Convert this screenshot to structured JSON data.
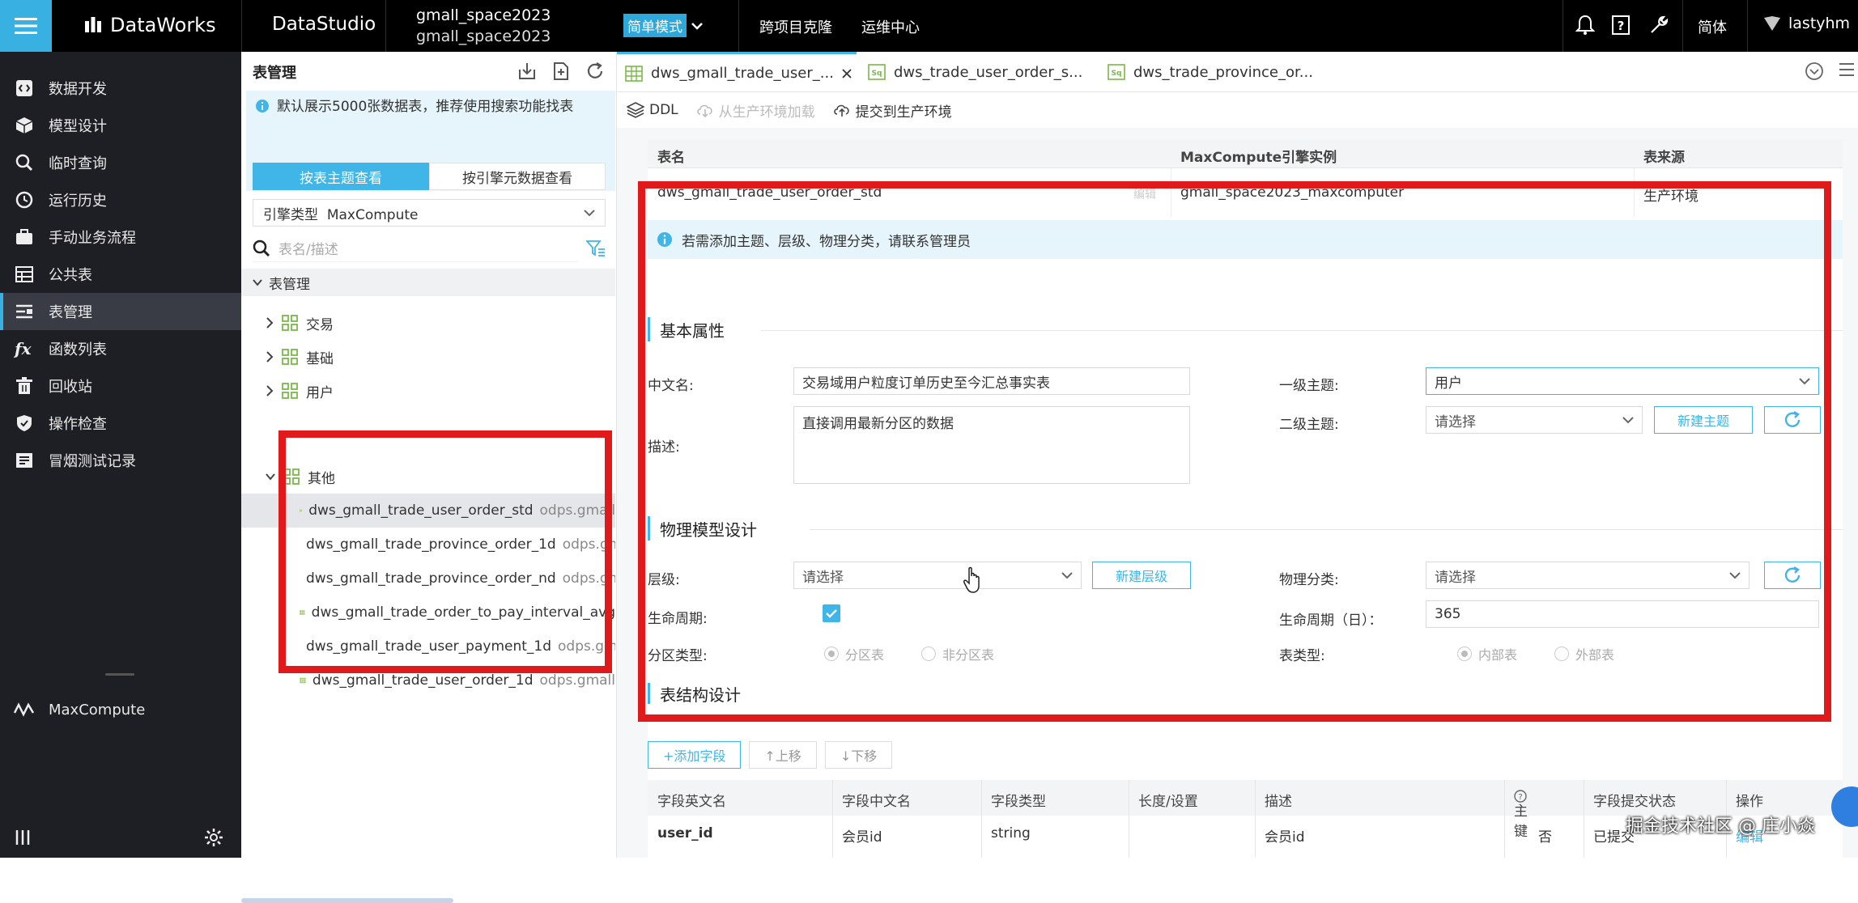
{
  "topbar": {
    "brand": "DataWorks",
    "studio": "DataStudio",
    "workspace_line1": "gmall_space2023",
    "workspace_line2": "gmall_space2023",
    "mode": "简单模式",
    "nav": [
      "跨项目克隆",
      "运维中心"
    ],
    "lang": "简体",
    "user": "lastyhm"
  },
  "sidebar": {
    "items": [
      {
        "label": "数据开发",
        "icon": "code-icon"
      },
      {
        "label": "模型设计",
        "icon": "cube-icon"
      },
      {
        "label": "临时查询",
        "icon": "search-icon"
      },
      {
        "label": "运行历史",
        "icon": "clock-icon"
      },
      {
        "label": "手动业务流程",
        "icon": "briefcase-icon"
      },
      {
        "label": "公共表",
        "icon": "table-icon"
      },
      {
        "label": "表管理",
        "icon": "table-manage-icon"
      },
      {
        "label": "函数列表",
        "icon": "function-icon"
      },
      {
        "label": "回收站",
        "icon": "trash-icon"
      },
      {
        "label": "操作检查",
        "icon": "shield-icon"
      },
      {
        "label": "冒烟测试记录",
        "icon": "record-icon"
      }
    ],
    "engine": "MaxCompute"
  },
  "tree": {
    "title": "表管理",
    "info": "默认展示5000张数据表，推荐使用搜索功能找表",
    "tab_subject": "按表主题查看",
    "tab_engine": "按引擎元数据查看",
    "engine_type_label": "引擎类型",
    "engine_type_value": "MaxCompute",
    "search_placeholder": "表名/描述",
    "root": "表管理",
    "folders": [
      "交易",
      "基础",
      "用户",
      "其他"
    ],
    "files": [
      {
        "name": "dws_gmall_trade_user_order_std",
        "path": "odps.gmall"
      },
      {
        "name": "dws_gmall_trade_province_order_1d",
        "path": "odps.gmall"
      },
      {
        "name": "dws_gmall_trade_province_order_nd",
        "path": "odps.gmall"
      },
      {
        "name": "dws_gmall_trade_order_to_pay_interval_avg",
        "path": ""
      },
      {
        "name": "dws_gmall_trade_user_payment_1d",
        "path": "odps.gmall"
      },
      {
        "name": "dws_gmall_trade_user_order_1d",
        "path": "odps.gmall"
      }
    ]
  },
  "editor": {
    "tabs": [
      "dws_gmall_trade_user_...",
      "dws_trade_user_order_s...",
      "dws_trade_province_or..."
    ],
    "toolbar": {
      "ddl": "DDL",
      "load": "从生产环境加载",
      "submit": "提交到生产环境"
    },
    "table_header": {
      "name": "表名",
      "instance": "MaxCompute引擎实例",
      "source": "表来源"
    },
    "table_row": {
      "name": "dws_gmall_trade_user_order_std",
      "edit": "编辑",
      "instance": "gmall_space2023_maxcomputer",
      "source": "生产环境"
    },
    "notice": "若需添加主题、层级、物理分类，请联系管理员",
    "basic": {
      "title": "基本属性",
      "cn_name_label": "中文名:",
      "cn_name_value": "交易域用户粒度订单历史至今汇总事实表",
      "desc_label": "描述:",
      "desc_value": "直接调用最新分区的数据",
      "subject1_label": "一级主题:",
      "subject1_value": "用户",
      "subject2_label": "二级主题:",
      "subject2_value": "请选择",
      "new_subject": "新建主题"
    },
    "physical": {
      "title": "物理模型设计",
      "layer_label": "层级:",
      "layer_value": "请选择",
      "new_layer": "新建层级",
      "category_label": "物理分类:",
      "category_value": "请选择",
      "lifecycle_label": "生命周期:",
      "lifecycle_days_label": "生命周期（日）：",
      "lifecycle_days_value": "365",
      "partition_label": "分区类型:",
      "partition_opt1": "分区表",
      "partition_opt2": "非分区表",
      "table_type_label": "表类型:",
      "table_type_opt1": "内部表",
      "table_type_opt2": "外部表"
    },
    "structure_title": "表结构设计",
    "field_buttons": {
      "add": "+添加字段",
      "up": "↑上移",
      "down": "↓下移"
    },
    "field_headers": [
      "字段英文名",
      "字段中文名",
      "字段类型",
      "长度/设置",
      "描述",
      "主键",
      "字段提交状态",
      "操作"
    ],
    "field_row": {
      "en": "user_id",
      "cn": "会员id",
      "type": "string",
      "len": "",
      "desc": "会员id",
      "pk": "否",
      "status": "已提交",
      "op": "编辑"
    }
  },
  "watermark": "掘金技术社区 @ 庄小焱",
  "colors": {
    "accent": "#3fb5e8",
    "highlight": "#e0191b",
    "sidebar": "#1e1f24"
  }
}
